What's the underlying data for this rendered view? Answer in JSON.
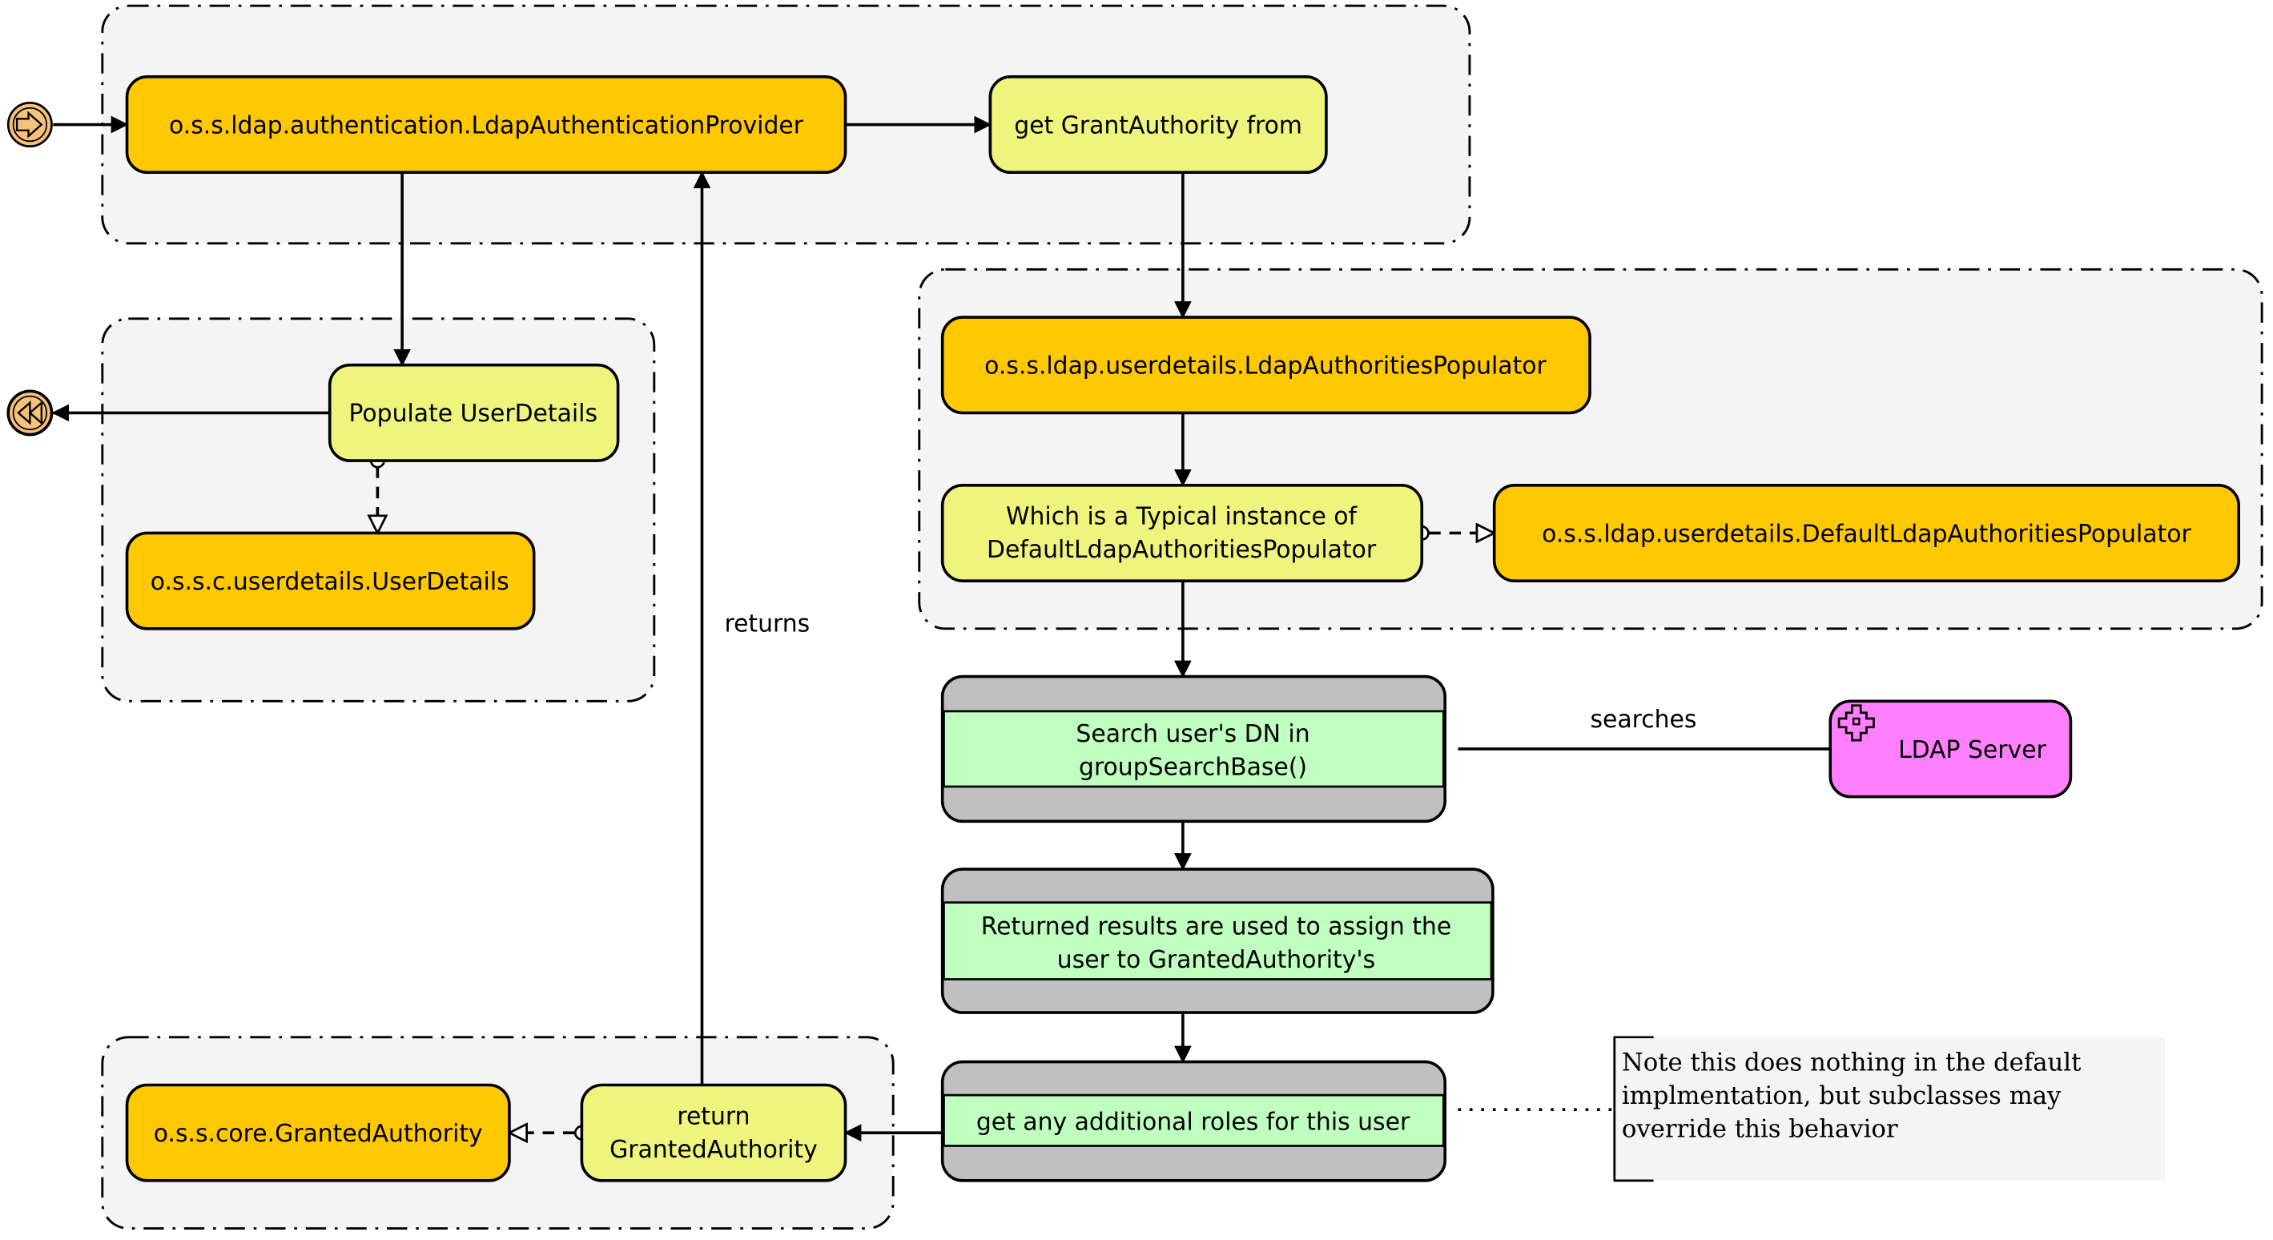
{
  "colors": {
    "class_box": "#ffc800",
    "step_box": "#eef47c",
    "task_band": "#c0c0c0",
    "task_body": "#bfffbf",
    "ldap_server": "#ff80ff",
    "group_fill": "#f4f4f4",
    "event": "#f6c27a"
  },
  "events": {
    "start_icon": "arrow-right-icon",
    "end_icon": "rewind-icon"
  },
  "nodes": {
    "ldap_auth_provider": "o.s.s.ldap.authentication.LdapAuthenticationProvider",
    "get_grant_authority": "get GrantAuthority from",
    "populate_user_details": "Populate UserDetails",
    "user_details": "o.s.s.c.userdetails.UserDetails",
    "ldap_authorities_populator": "o.s.s.ldap.userdetails.LdapAuthoritiesPopulator",
    "typical_instance_line1": "Which is a Typical instance of",
    "typical_instance_line2": "DefaultLdapAuthoritiesPopulator",
    "default_populator": "o.s.s.ldap.userdetails.DefaultLdapAuthoritiesPopulator",
    "search_dn_line1": "Search user's DN in",
    "search_dn_line2": "groupSearchBase()",
    "ldap_server": "LDAP Server",
    "returned_results_line1": "Returned results are used to assign the",
    "returned_results_line2": "user to GrantedAuthority's",
    "additional_roles": "get any additional roles for this user",
    "granted_authority": "o.s.s.core.GrantedAuthority",
    "return_line1": "return",
    "return_line2": "GrantedAuthority"
  },
  "edge_labels": {
    "returns": "returns",
    "searches": "searches"
  },
  "note": {
    "line1": "Note this does nothing in the default",
    "line2": "implmentation, but subclasses may",
    "line3": "override this behavior"
  }
}
